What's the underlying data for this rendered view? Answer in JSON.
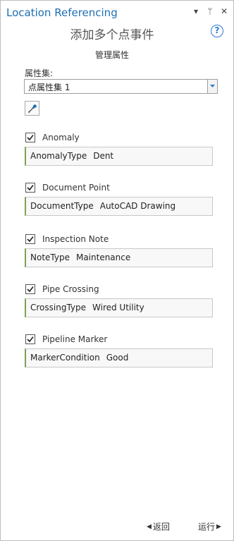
{
  "pane": {
    "title": "Location Referencing",
    "controls": [
      "▾",
      "ᛘ",
      "✕"
    ],
    "subtitle": "添加多个点事件",
    "help_glyph": "?"
  },
  "section": {
    "heading": "管理属性"
  },
  "attribute_set": {
    "label": "属性集:",
    "selected": "点属性集 1"
  },
  "items": [
    {
      "label": "Anomaly",
      "checked": true,
      "field": "AnomalyType",
      "value": "Dent"
    },
    {
      "label": "Document Point",
      "checked": true,
      "field": "DocumentType",
      "value": "AutoCAD Drawing"
    },
    {
      "label": "Inspection Note",
      "checked": true,
      "field": "NoteType",
      "value": "Maintenance"
    },
    {
      "label": "Pipe Crossing",
      "checked": true,
      "field": "CrossingType",
      "value": "Wired Utility"
    },
    {
      "label": "Pipeline Marker",
      "checked": true,
      "field": "MarkerCondition",
      "value": "Good"
    }
  ],
  "footer": {
    "back_label": "返回",
    "run_label": "运行"
  },
  "colors": {
    "title_blue": "#1f6fb3",
    "accent_green": "#7aa35a",
    "help_blue": "#2b7bd1"
  }
}
